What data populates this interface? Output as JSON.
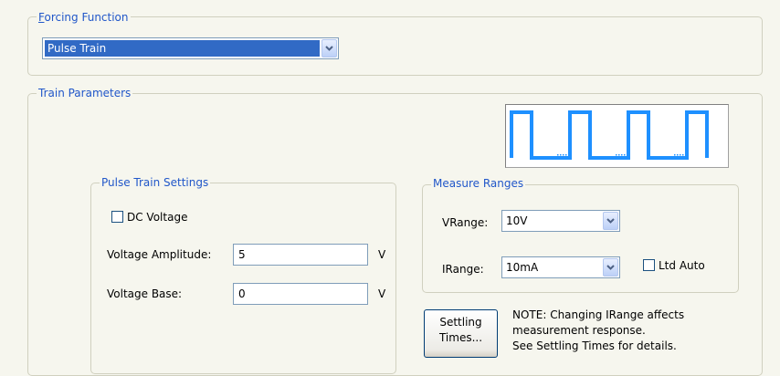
{
  "forcing_function": {
    "legend_mnemonic": "F",
    "legend_rest": "orcing Function",
    "selected": "Pulse Train"
  },
  "train_parameters": {
    "legend": "Train Parameters"
  },
  "pulse_train_settings": {
    "legend": "Pulse Train Settings",
    "dc_voltage_label": "DC Voltage",
    "dc_voltage_checked": false,
    "amplitude_label": "Voltage Amplitude:",
    "amplitude_value": "5",
    "amplitude_unit": "V",
    "base_label": "Voltage Base:",
    "base_value": "0",
    "base_unit": "V"
  },
  "measure_ranges": {
    "legend": "Measure Ranges",
    "vrange_label": "VRange:",
    "vrange_value": "10V",
    "irange_label": "IRange:",
    "irange_value": "10mA",
    "ltd_auto_label": "Ltd Auto",
    "ltd_auto_checked": false
  },
  "settling_button": {
    "line1": "Settling",
    "line2": "Times..."
  },
  "note": {
    "line1": "NOTE: Changing IRange affects",
    "line2": "measurement response.",
    "line3": "See Settling Times for details."
  },
  "colors": {
    "accent": "#2157c9",
    "waveform": "#1e90ff",
    "selection": "#316ac5"
  },
  "icons": {
    "dropdown": "chevron-down-icon",
    "waveform": "pulse-train-waveform-icon"
  }
}
